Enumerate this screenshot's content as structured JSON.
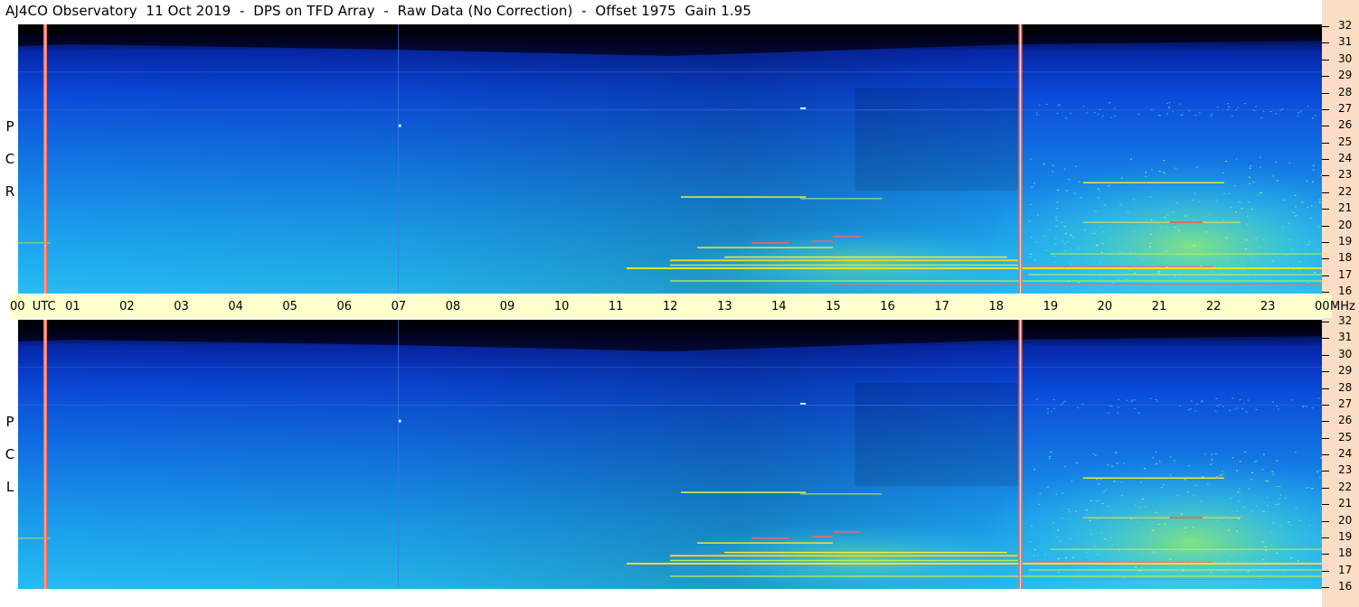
{
  "title": "AJ4CO Observatory  11 Oct 2019  -  DPS on TFD Array  -  Raw Data (No Correction)  -  Offset 1975  Gain 1.95",
  "panels": [
    {
      "id": "rcp",
      "label_letters": [
        "R",
        "C",
        "P"
      ]
    },
    {
      "id": "lcp",
      "label_letters": [
        "L",
        "C",
        "P"
      ]
    }
  ],
  "time_axis": {
    "labels": [
      "00  UTC",
      "01",
      "02",
      "03",
      "04",
      "05",
      "06",
      "07",
      "08",
      "09",
      "10",
      "11",
      "12",
      "13",
      "14",
      "15",
      "16",
      "17",
      "18",
      "19",
      "20",
      "21",
      "22",
      "23",
      "00"
    ],
    "unit": "MHz"
  },
  "freq_axis": {
    "labels": [
      "32",
      "31",
      "30",
      "29",
      "28",
      "27",
      "26",
      "25",
      "24",
      "23",
      "22",
      "21",
      "20",
      "19",
      "18",
      "17",
      "16"
    ]
  },
  "chart_data": {
    "type": "heatmap",
    "title": "AJ4CO Observatory  11 Oct 2019  -  DPS on TFD Array  -  Raw Data (No Correction)  -  Offset 1975  Gain 1.95",
    "x": {
      "label": "UTC",
      "range": [
        0,
        24
      ],
      "ticks": [
        "00",
        "01",
        "02",
        "03",
        "04",
        "05",
        "06",
        "07",
        "08",
        "09",
        "10",
        "11",
        "12",
        "13",
        "14",
        "15",
        "16",
        "17",
        "18",
        "19",
        "20",
        "21",
        "22",
        "23",
        "00"
      ]
    },
    "y": {
      "label": "MHz",
      "range": [
        16,
        32
      ],
      "ticks": [
        32,
        31,
        30,
        29,
        28,
        27,
        26,
        25,
        24,
        23,
        22,
        21,
        20,
        19,
        18,
        17,
        16
      ]
    },
    "series": [
      {
        "name": "RCP"
      },
      {
        "name": "LCP"
      }
    ],
    "colormap": [
      "#000018",
      "#041c6e",
      "#0a3bc8",
      "#1a78e0",
      "#22a8f0",
      "#40d8e8",
      "#b0f060",
      "#ffe020",
      "#ff4040"
    ],
    "vertical_markers_utc": [
      0.5,
      18.45
    ],
    "marker_color": "#ff6a5a"
  }
}
